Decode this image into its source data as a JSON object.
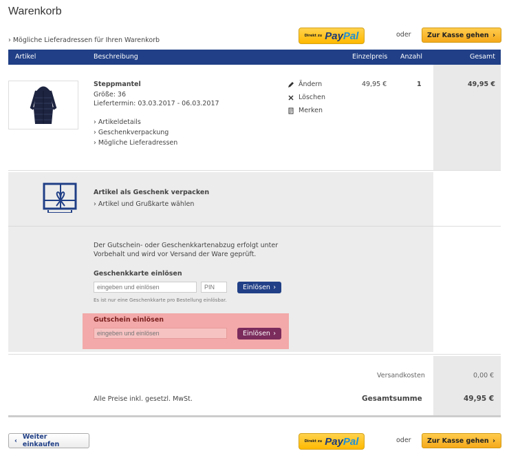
{
  "page": {
    "title": "Warenkorb"
  },
  "top": {
    "delivery_link": "› Mögliche Lieferadressen für Ihren Warenkorb",
    "or": "oder"
  },
  "paypal": {
    "small": "Direkt zu",
    "pay": "Pay",
    "pal": "Pal"
  },
  "checkout": {
    "label": "Zur Kasse gehen",
    "arrow": "›"
  },
  "table": {
    "headers": {
      "artikel": "Artikel",
      "beschreibung": "Beschreibung",
      "einzelpreis": "Einzelpreis",
      "anzahl": "Anzahl",
      "gesamt": "Gesamt"
    }
  },
  "item": {
    "name": "Steppmantel",
    "size": "Größe: 36",
    "delivery": "Liefertermin: 03.03.2017 - 06.03.2017",
    "links": [
      "› Artikeldetails",
      "› Geschenkverpackung",
      "› Mögliche Lieferadressen"
    ],
    "actions": {
      "edit": "Ändern",
      "delete": "Löschen",
      "save": "Merken"
    },
    "unit_price": "49,95 €",
    "quantity": "1",
    "total": "49,95 €"
  },
  "gift": {
    "title": "Artikel als Geschenk verpacken",
    "link": "› Artikel und Grußkarte wählen"
  },
  "voucher": {
    "note_line1": "Der Gutschein- oder Geschenkkartenabzug erfolgt unter",
    "note_line2": "Vorbehalt und wird vor Versand der Ware geprüft.",
    "giftcard_title": "Geschenkkarte einlösen",
    "giftcard_placeholder": "eingeben und einlösen",
    "pin_placeholder": "PIN",
    "redeem_label": "Einlösen",
    "giftcard_hint": "Es ist nur eine Geschenkkarte pro Bestellung einlösbar.",
    "coupon_title": "Gutschein einlösen",
    "coupon_placeholder": "eingeben und einlösen",
    "arrow": "›"
  },
  "summary": {
    "shipping_label": "Versandkosten",
    "shipping_value": "0,00 €",
    "vat_note": "Alle Preise inkl. gesetzl. MwSt.",
    "total_label": "Gesamtsumme",
    "total_value": "49,95 €"
  },
  "bottom": {
    "continue_label": "Weiter einkaufen",
    "continue_arrow": "‹",
    "or": "oder"
  }
}
